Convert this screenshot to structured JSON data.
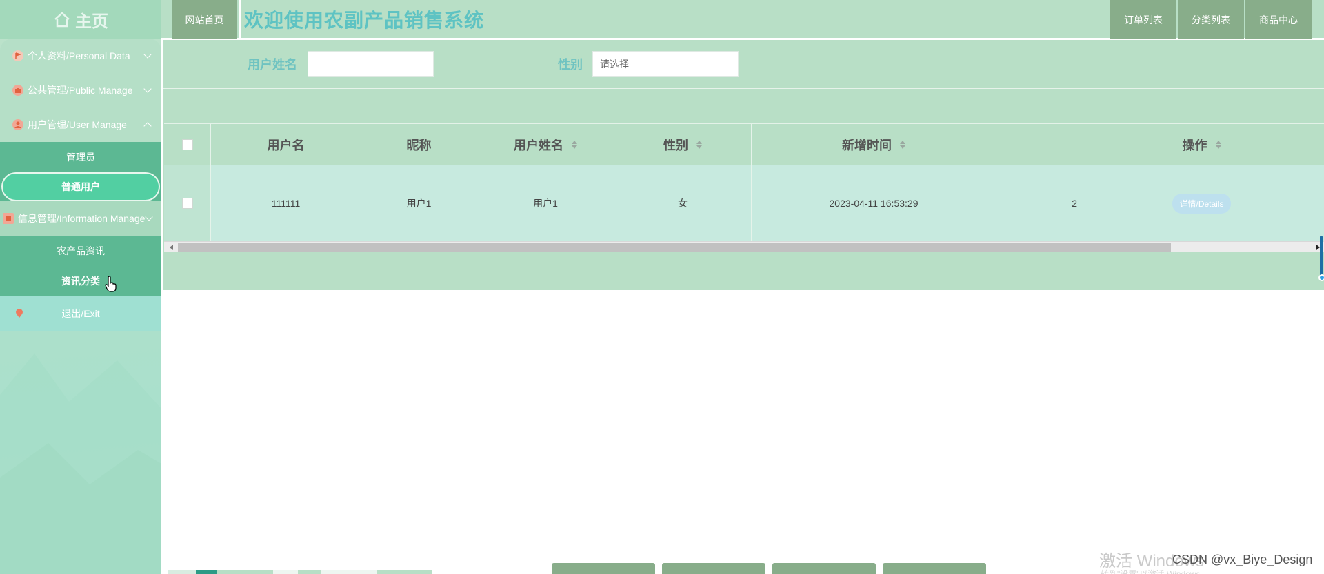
{
  "sidebar": {
    "brand": "主页",
    "items": [
      {
        "label": "个人资料/Personal Data",
        "icon": "flag-icon"
      },
      {
        "label": "公共管理/Public Manage",
        "icon": "puzzle-icon"
      },
      {
        "label": "用户管理/User Manage",
        "icon": "user-icon"
      }
    ],
    "user_sub": [
      "管理员",
      "普通用户"
    ],
    "info_item": "信息管理/Information Manage",
    "info_sub": [
      "农产品资讯",
      "资讯分类"
    ],
    "exit": "退出/Exit"
  },
  "topbar": {
    "home": "网站首页",
    "title": "欢迎使用农副产品销售系统",
    "right_buttons": [
      "订单列表",
      "分类列表",
      "商品中心"
    ]
  },
  "search": {
    "name_label": "用户姓名",
    "name_value": "",
    "gender_label": "性别",
    "gender_placeholder": "请选择"
  },
  "table": {
    "headers": [
      "用户名",
      "昵称",
      "用户姓名",
      "性别",
      "新增时间",
      "操作"
    ],
    "rows": [
      {
        "username": "111111",
        "nickname": "用户1",
        "realname": "用户1",
        "gender": "女",
        "created": "2023-04-11 16:53:29",
        "truncated": "2",
        "action": "详情/Details"
      }
    ]
  },
  "watermark": {
    "activate": "激活 Windows",
    "sub": "转到\"设置\"以激活 Windows。",
    "csdn": "CSDN @vx_Biye_Design"
  },
  "colors": {
    "accent": "#88ad8a",
    "panel": "#b8dfc6",
    "title": "#5ec3c3",
    "active": "#52cfa2"
  }
}
